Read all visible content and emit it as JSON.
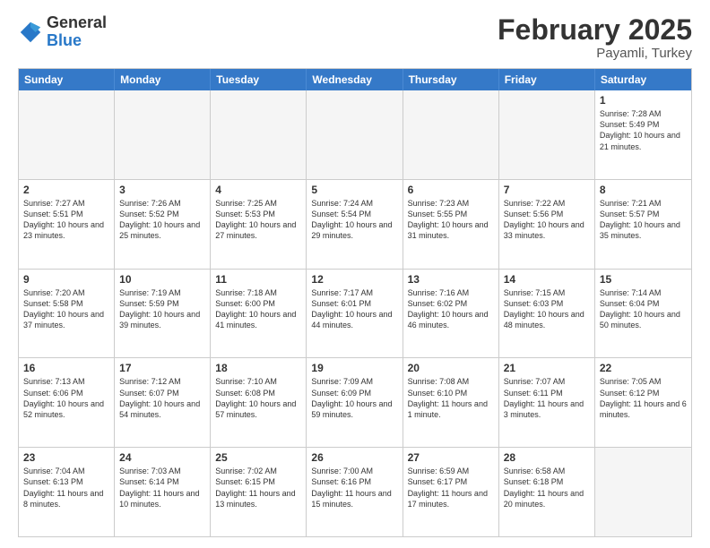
{
  "logo": {
    "general": "General",
    "blue": "Blue"
  },
  "title": {
    "month": "February 2025",
    "location": "Payamli, Turkey"
  },
  "weekdays": [
    "Sunday",
    "Monday",
    "Tuesday",
    "Wednesday",
    "Thursday",
    "Friday",
    "Saturday"
  ],
  "weeks": [
    [
      {
        "day": "",
        "info": "",
        "empty": true
      },
      {
        "day": "",
        "info": "",
        "empty": true
      },
      {
        "day": "",
        "info": "",
        "empty": true
      },
      {
        "day": "",
        "info": "",
        "empty": true
      },
      {
        "day": "",
        "info": "",
        "empty": true
      },
      {
        "day": "",
        "info": "",
        "empty": true
      },
      {
        "day": "1",
        "info": "Sunrise: 7:28 AM\nSunset: 5:49 PM\nDaylight: 10 hours\nand 21 minutes.",
        "empty": false
      }
    ],
    [
      {
        "day": "2",
        "info": "Sunrise: 7:27 AM\nSunset: 5:51 PM\nDaylight: 10 hours\nand 23 minutes.",
        "empty": false
      },
      {
        "day": "3",
        "info": "Sunrise: 7:26 AM\nSunset: 5:52 PM\nDaylight: 10 hours\nand 25 minutes.",
        "empty": false
      },
      {
        "day": "4",
        "info": "Sunrise: 7:25 AM\nSunset: 5:53 PM\nDaylight: 10 hours\nand 27 minutes.",
        "empty": false
      },
      {
        "day": "5",
        "info": "Sunrise: 7:24 AM\nSunset: 5:54 PM\nDaylight: 10 hours\nand 29 minutes.",
        "empty": false
      },
      {
        "day": "6",
        "info": "Sunrise: 7:23 AM\nSunset: 5:55 PM\nDaylight: 10 hours\nand 31 minutes.",
        "empty": false
      },
      {
        "day": "7",
        "info": "Sunrise: 7:22 AM\nSunset: 5:56 PM\nDaylight: 10 hours\nand 33 minutes.",
        "empty": false
      },
      {
        "day": "8",
        "info": "Sunrise: 7:21 AM\nSunset: 5:57 PM\nDaylight: 10 hours\nand 35 minutes.",
        "empty": false
      }
    ],
    [
      {
        "day": "9",
        "info": "Sunrise: 7:20 AM\nSunset: 5:58 PM\nDaylight: 10 hours\nand 37 minutes.",
        "empty": false
      },
      {
        "day": "10",
        "info": "Sunrise: 7:19 AM\nSunset: 5:59 PM\nDaylight: 10 hours\nand 39 minutes.",
        "empty": false
      },
      {
        "day": "11",
        "info": "Sunrise: 7:18 AM\nSunset: 6:00 PM\nDaylight: 10 hours\nand 41 minutes.",
        "empty": false
      },
      {
        "day": "12",
        "info": "Sunrise: 7:17 AM\nSunset: 6:01 PM\nDaylight: 10 hours\nand 44 minutes.",
        "empty": false
      },
      {
        "day": "13",
        "info": "Sunrise: 7:16 AM\nSunset: 6:02 PM\nDaylight: 10 hours\nand 46 minutes.",
        "empty": false
      },
      {
        "day": "14",
        "info": "Sunrise: 7:15 AM\nSunset: 6:03 PM\nDaylight: 10 hours\nand 48 minutes.",
        "empty": false
      },
      {
        "day": "15",
        "info": "Sunrise: 7:14 AM\nSunset: 6:04 PM\nDaylight: 10 hours\nand 50 minutes.",
        "empty": false
      }
    ],
    [
      {
        "day": "16",
        "info": "Sunrise: 7:13 AM\nSunset: 6:06 PM\nDaylight: 10 hours\nand 52 minutes.",
        "empty": false
      },
      {
        "day": "17",
        "info": "Sunrise: 7:12 AM\nSunset: 6:07 PM\nDaylight: 10 hours\nand 54 minutes.",
        "empty": false
      },
      {
        "day": "18",
        "info": "Sunrise: 7:10 AM\nSunset: 6:08 PM\nDaylight: 10 hours\nand 57 minutes.",
        "empty": false
      },
      {
        "day": "19",
        "info": "Sunrise: 7:09 AM\nSunset: 6:09 PM\nDaylight: 10 hours\nand 59 minutes.",
        "empty": false
      },
      {
        "day": "20",
        "info": "Sunrise: 7:08 AM\nSunset: 6:10 PM\nDaylight: 11 hours\nand 1 minute.",
        "empty": false
      },
      {
        "day": "21",
        "info": "Sunrise: 7:07 AM\nSunset: 6:11 PM\nDaylight: 11 hours\nand 3 minutes.",
        "empty": false
      },
      {
        "day": "22",
        "info": "Sunrise: 7:05 AM\nSunset: 6:12 PM\nDaylight: 11 hours\nand 6 minutes.",
        "empty": false
      }
    ],
    [
      {
        "day": "23",
        "info": "Sunrise: 7:04 AM\nSunset: 6:13 PM\nDaylight: 11 hours\nand 8 minutes.",
        "empty": false
      },
      {
        "day": "24",
        "info": "Sunrise: 7:03 AM\nSunset: 6:14 PM\nDaylight: 11 hours\nand 10 minutes.",
        "empty": false
      },
      {
        "day": "25",
        "info": "Sunrise: 7:02 AM\nSunset: 6:15 PM\nDaylight: 11 hours\nand 13 minutes.",
        "empty": false
      },
      {
        "day": "26",
        "info": "Sunrise: 7:00 AM\nSunset: 6:16 PM\nDaylight: 11 hours\nand 15 minutes.",
        "empty": false
      },
      {
        "day": "27",
        "info": "Sunrise: 6:59 AM\nSunset: 6:17 PM\nDaylight: 11 hours\nand 17 minutes.",
        "empty": false
      },
      {
        "day": "28",
        "info": "Sunrise: 6:58 AM\nSunset: 6:18 PM\nDaylight: 11 hours\nand 20 minutes.",
        "empty": false
      },
      {
        "day": "",
        "info": "",
        "empty": true
      }
    ]
  ]
}
